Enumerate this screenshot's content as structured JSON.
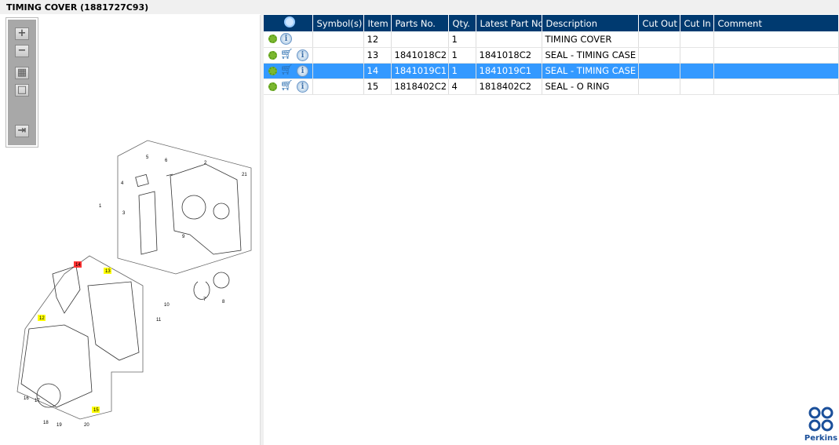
{
  "window": {
    "title": "TIMING COVER (1881727C93)"
  },
  "toolbar": {
    "zoom_in": "+",
    "zoom_out": "−",
    "fit": "▦",
    "actual": "□",
    "panel": "⇥"
  },
  "table": {
    "headers": [
      "",
      "Symbol(s)",
      "Item",
      "Parts No.",
      "Qty.",
      "Latest Part No.",
      "Description",
      "Cut Out",
      "Cut In",
      "Comment"
    ],
    "rows": [
      {
        "item": "12",
        "parts_no": "",
        "qty": "1",
        "latest": "",
        "description": "TIMING COVER",
        "cart": false,
        "selected": false
      },
      {
        "item": "13",
        "parts_no": "1841018C2",
        "qty": "1",
        "latest": "1841018C2",
        "description": "SEAL - TIMING CASE CO",
        "cart": true,
        "selected": false
      },
      {
        "item": "14",
        "parts_no": "1841019C1",
        "qty": "1",
        "latest": "1841019C1",
        "description": "SEAL - TIMING CASE CO",
        "cart": true,
        "selected": true
      },
      {
        "item": "15",
        "parts_no": "1818402C2",
        "qty": "4",
        "latest": "1818402C2",
        "description": "SEAL - O RING",
        "cart": true,
        "selected": false
      }
    ]
  },
  "diagram": {
    "callouts": [
      "1",
      "2",
      "3",
      "4",
      "5",
      "6",
      "7",
      "8",
      "9",
      "10",
      "11",
      "12",
      "13",
      "14",
      "15",
      "16",
      "17",
      "18",
      "19",
      "20",
      "21"
    ],
    "highlight_color": "#ffff00",
    "selected_color": "#ff3333"
  },
  "brand": {
    "name": "Perkins",
    "color": "#1a4f9a"
  }
}
